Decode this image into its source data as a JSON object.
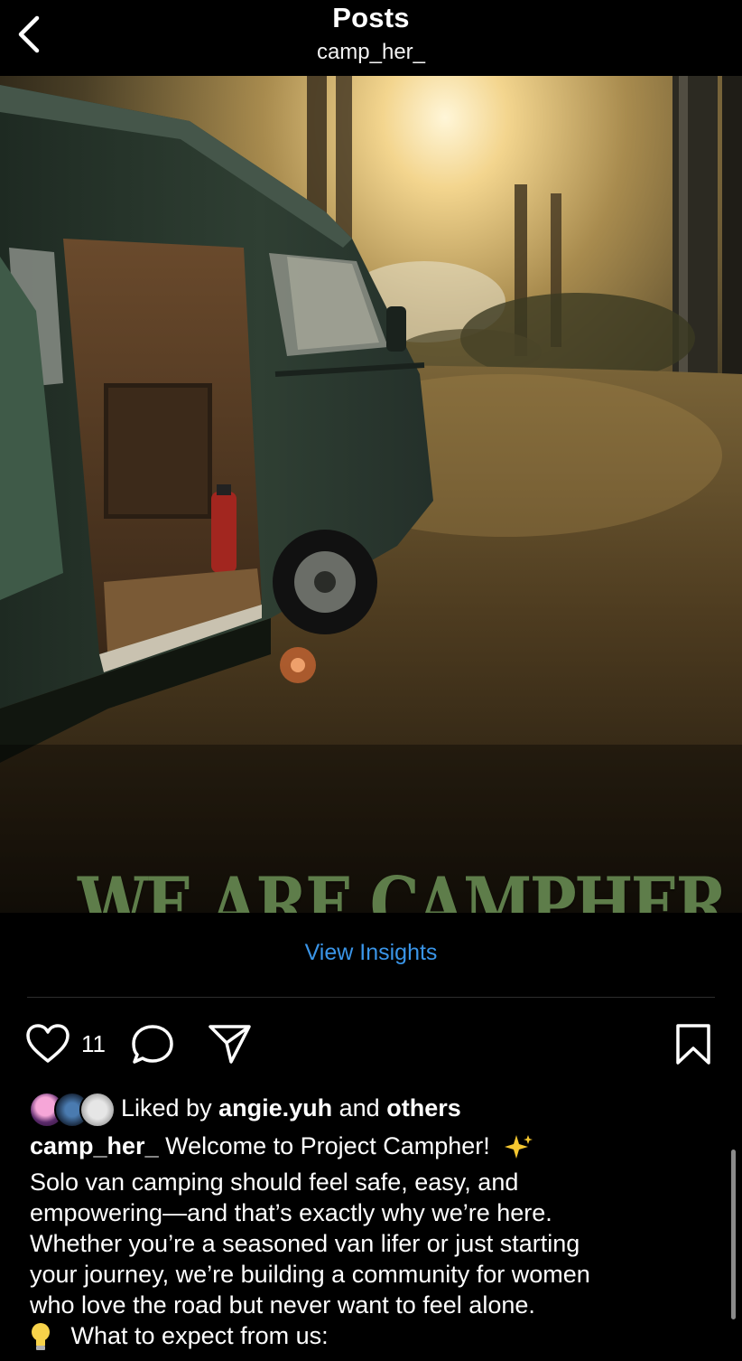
{
  "header": {
    "title": "Posts",
    "username": "camp_her_",
    "back_icon": "chevron-left-icon"
  },
  "post": {
    "overlay_text": "WE ARE CAMPHER",
    "overlay_color": "#5e7d4a"
  },
  "insights": {
    "label": "View Insights",
    "color": "#3a95e8"
  },
  "actions": {
    "like_icon": "heart-outline-icon",
    "like_count": "11",
    "comment_icon": "comment-bubble-icon",
    "share_icon": "paper-plane-icon",
    "save_icon": "bookmark-outline-icon"
  },
  "likes": {
    "prefix": "Liked by",
    "user": "angie.yuh",
    "connector": "and",
    "others": "others"
  },
  "caption": {
    "username": "camp_her_",
    "first_line": "Welcome to Project Campher!",
    "lines": [
      "Solo van camping should feel safe, easy, and",
      "empowering—and that’s exactly why we’re here.",
      "Whether you’re a seasoned van lifer or just starting",
      "your journey, we’re building a community for women",
      "who love the road but never want to feel alone."
    ],
    "expect_line": "What to expect from us:"
  }
}
